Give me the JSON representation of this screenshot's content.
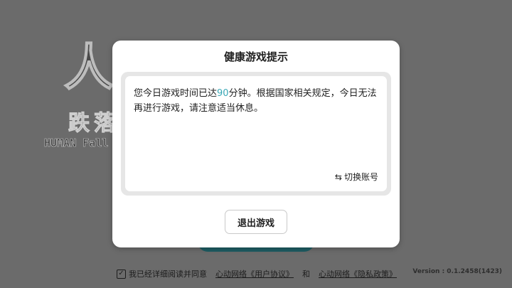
{
  "background": {
    "logo": {
      "main_char": "人",
      "sub_title": "跌落",
      "english_title": "HUMAN Fall Flat"
    },
    "agreement": {
      "checked": true,
      "prefix": "我已经详细阅读并同意",
      "user_agreement": "心动网络《用户协议》",
      "and": "和",
      "privacy_policy": "心动网络《隐私政策》"
    },
    "version": "Version : 0.1.2458(1423)"
  },
  "dialog": {
    "title": "健康游戏提示",
    "message_before": "您今日游戏时间已达",
    "minutes": "90",
    "message_after": "分钟。根据国家相关规定，今日无法再进行游戏，请注意适当休息。",
    "switch_account_label": "切换账号",
    "switch_account_icon": "swap-arrows-icon",
    "exit_button_label": "退出游戏"
  },
  "colors": {
    "overlay_bg": "#6b6b6b",
    "highlight": "#3aa8b6",
    "start_button": "#1e5d63"
  }
}
